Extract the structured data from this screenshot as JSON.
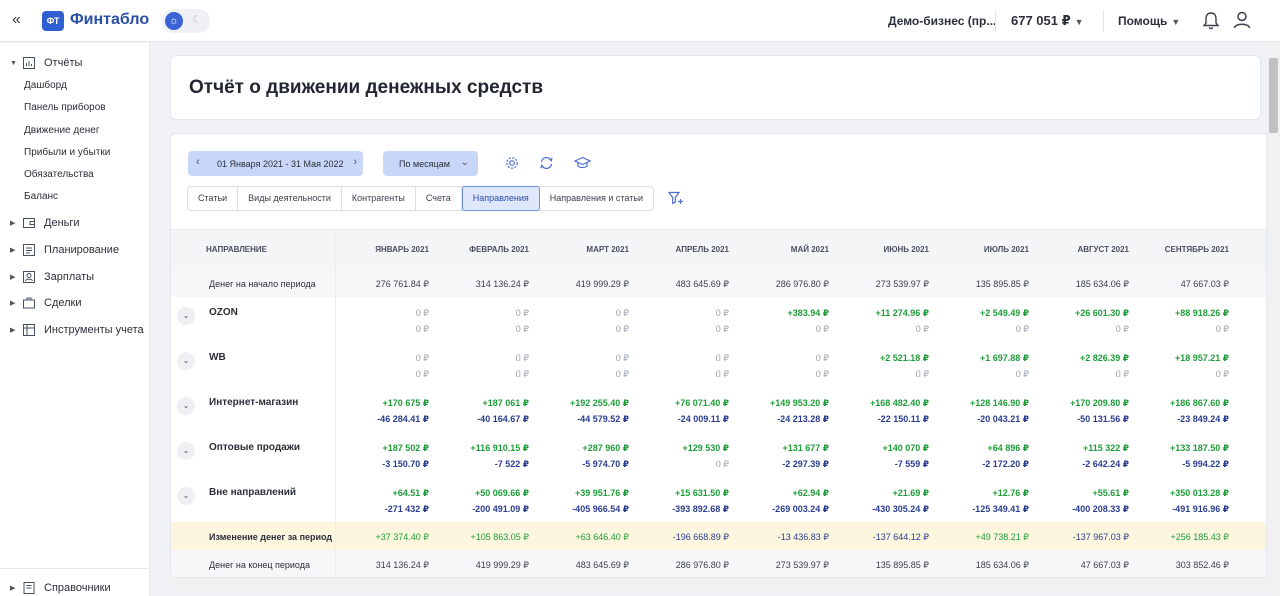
{
  "app": {
    "collapse_icon": "«",
    "logo_badge": "ФТ",
    "logo_text": "Финтабло",
    "business": "Демо-бизнес (пр...",
    "balance": "677 051 ₽",
    "help": "Помощь"
  },
  "sidebar": {
    "reports": "Отчёты",
    "sub": [
      "Дашборд",
      "Панель приборов",
      "Движение денег",
      "Прибыли и убытки",
      "Обязательства",
      "Баланс"
    ],
    "money": "Деньги",
    "planning": "Планирование",
    "salaries": "Зарплаты",
    "deals": "Сделки",
    "tools": "Инструменты учета",
    "refs": "Справочники"
  },
  "page": {
    "title": "Отчёт о движении денежных средств"
  },
  "toolbar": {
    "date_range": "01 Января 2021 - 31 Мая 2022",
    "period": "По месяцам",
    "tabs": [
      "Статьи",
      "Виды деятельности",
      "Контрагенты",
      "Счета",
      "Направления",
      "Направления и статьи"
    ],
    "active_tab": 4
  },
  "table": {
    "first_header": "НАПРАВЛЕНИЕ",
    "months": [
      "ЯНВАРЬ 2021",
      "ФЕВРАЛЬ 2021",
      "МАРТ 2021",
      "АПРЕЛЬ 2021",
      "МАЙ 2021",
      "ИЮНЬ 2021",
      "ИЮЛЬ 2021",
      "АВГУСТ 2021",
      "СЕНТЯБРЬ 2021"
    ],
    "start_label": "Денег на начало периода",
    "start": [
      "276 761.84 ₽",
      "314 136.24 ₽",
      "419 999.29 ₽",
      "483 645.69 ₽",
      "286 976.80 ₽",
      "273 539.97 ₽",
      "135 895.85 ₽",
      "185 634.06 ₽",
      "47 667.03 ₽"
    ],
    "groups": [
      {
        "name": "OZON",
        "in": [
          "0 ₽",
          "0 ₽",
          "0 ₽",
          "0 ₽",
          "+383.94 ₽",
          "+11 274.96 ₽",
          "+2 549.49 ₽",
          "+26 601.30 ₽",
          "+88 918.26 ₽"
        ],
        "out": [
          "0 ₽",
          "0 ₽",
          "0 ₽",
          "0 ₽",
          "0 ₽",
          "0 ₽",
          "0 ₽",
          "0 ₽",
          "0 ₽"
        ]
      },
      {
        "name": "WB",
        "in": [
          "0 ₽",
          "0 ₽",
          "0 ₽",
          "0 ₽",
          "0 ₽",
          "+2 521.18 ₽",
          "+1 697.88 ₽",
          "+2 826.39 ₽",
          "+18 957.21 ₽"
        ],
        "out": [
          "0 ₽",
          "0 ₽",
          "0 ₽",
          "0 ₽",
          "0 ₽",
          "0 ₽",
          "0 ₽",
          "0 ₽",
          "0 ₽"
        ]
      },
      {
        "name": "Интернет-магазин",
        "in": [
          "+170 675 ₽",
          "+187 061 ₽",
          "+192 255.40 ₽",
          "+76 071.40 ₽",
          "+149 953.20 ₽",
          "+168 482.40 ₽",
          "+128 146.90 ₽",
          "+170 209.80 ₽",
          "+186 867.60 ₽"
        ],
        "out": [
          "-46 284.41 ₽",
          "-40 164.67 ₽",
          "-44 579.52 ₽",
          "-24 009.11 ₽",
          "-24 213.28 ₽",
          "-22 150.11 ₽",
          "-20 043.21 ₽",
          "-50 131.56 ₽",
          "-23 849.24 ₽"
        ]
      },
      {
        "name": "Оптовые продажи",
        "in": [
          "+187 502 ₽",
          "+116 910.15 ₽",
          "+287 960 ₽",
          "+129 530 ₽",
          "+131 677 ₽",
          "+140 070 ₽",
          "+64 896 ₽",
          "+115 322 ₽",
          "+133 187.50 ₽"
        ],
        "out": [
          "-3 150.70 ₽",
          "-7 522 ₽",
          "-5 974.70 ₽",
          "0 ₽",
          "-2 297.39 ₽",
          "-7 559 ₽",
          "-2 172.20 ₽",
          "-2 642.24 ₽",
          "-5 994.22 ₽"
        ]
      },
      {
        "name": "Вне направлений",
        "in": [
          "+64.51 ₽",
          "+50 069.66 ₽",
          "+39 951.76 ₽",
          "+15 631.50 ₽",
          "+62.94 ₽",
          "+21.69 ₽",
          "+12.76 ₽",
          "+55.61 ₽",
          "+350 013.28 ₽"
        ],
        "out": [
          "-271 432 ₽",
          "-200 491.09 ₽",
          "-405 966.54 ₽",
          "-393 892.68 ₽",
          "-269 003.24 ₽",
          "-430 305.24 ₽",
          "-125 349.41 ₽",
          "-400 208.33 ₽",
          "-491 916.96 ₽"
        ]
      }
    ],
    "change_label": "Изменение денег за период",
    "change": [
      "+37 374.40 ₽",
      "+105 863.05 ₽",
      "+63 646.40 ₽",
      "-196 668.89 ₽",
      "-13 436.83 ₽",
      "-137 644.12 ₽",
      "+49 738.21 ₽",
      "-137 967.03 ₽",
      "+256 185.43 ₽"
    ],
    "end_label": "Денег на конец периода",
    "end": [
      "314 136.24 ₽",
      "419 999.29 ₽",
      "483 645.69 ₽",
      "286 976.80 ₽",
      "273 539.97 ₽",
      "135 895.85 ₽",
      "185 634.06 ₽",
      "47 667.03 ₽",
      "303 852.46 ₽"
    ]
  }
}
